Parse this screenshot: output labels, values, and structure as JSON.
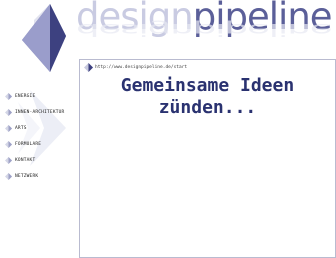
{
  "header": {
    "brand_light": "design",
    "brand_strong": "pipeline",
    "brand_reflection": "designpipeline"
  },
  "nav": {
    "items": [
      {
        "label": "ENERGIE"
      },
      {
        "label": "INNEN-ARCHITEKTUR"
      },
      {
        "label": "ARTS"
      },
      {
        "label": "FORMULARE"
      },
      {
        "label": "KONTAKT"
      },
      {
        "label": "NETZWERK"
      }
    ]
  },
  "content": {
    "url": "http://www.designpipeline.de/start",
    "headline_line1": "Gemeinsame Ideen",
    "headline_line2": "zünden..."
  },
  "colors": {
    "brand_strong": "#5b5f99",
    "brand_light": "#c9cbe2",
    "headline": "#2a3270",
    "border": "#b9bbd0"
  }
}
